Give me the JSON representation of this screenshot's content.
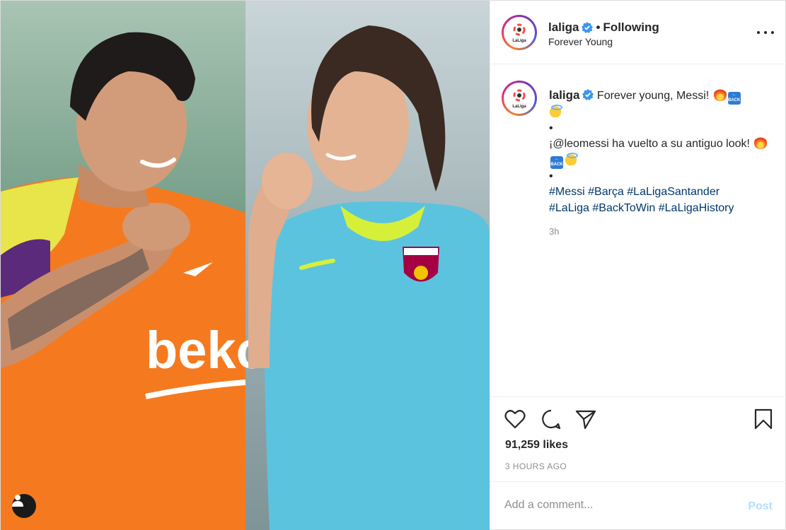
{
  "post": {
    "media": {
      "description_icon": "person-icon",
      "shirt_text": "beko"
    },
    "header": {
      "username": "laliga",
      "separator": "•",
      "follow_status": "Following",
      "subtitle": "Forever Young",
      "avatar_text": "LaLiga"
    },
    "caption": {
      "username": "laliga",
      "line1": "Forever young, Messi!",
      "bullet1": "•",
      "line2": "¡@leomessi ha vuelto a su antiguo look!",
      "bullet2": "•",
      "hashtags_line1": "#Messi #Barça #LaLigaSantander",
      "hashtags_line2": "#LaLiga #BackToWin #LaLigaHistory",
      "time": "3h",
      "emoji_back": "BACK"
    },
    "stats": {
      "likes": "91,259 likes",
      "posted_ago": "3 HOURS AGO"
    },
    "comment": {
      "placeholder": "Add a comment...",
      "post_label": "Post"
    },
    "colors": {
      "link": "#00376b",
      "muted": "#8e8e8e",
      "post_button": "#b2dffc",
      "verified": "#3897f0"
    }
  }
}
